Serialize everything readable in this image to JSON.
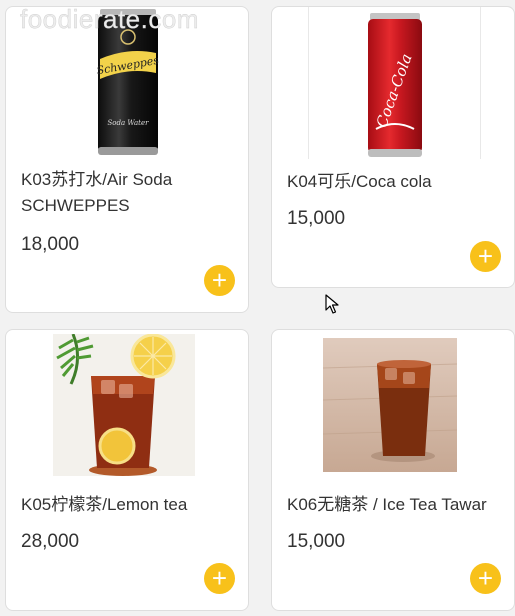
{
  "watermark": "foodierate.com",
  "accent_color": "#f8c11a",
  "add_icon": "plus-circle-icon",
  "products": [
    {
      "name": "K03苏打水/Air Soda SCHWEPPES",
      "price": "18,000",
      "image": "schweppes-soda-can"
    },
    {
      "name": "K04可乐/Coca cola",
      "price": "15,000",
      "image": "coca-cola-can"
    },
    {
      "name": "K05柠檬茶/Lemon tea",
      "price": "28,000",
      "image": "lemon-tea-glass"
    },
    {
      "name": "K06无糖茶 / Ice Tea Tawar",
      "price": "15,000",
      "image": "iced-tea-glass"
    }
  ]
}
